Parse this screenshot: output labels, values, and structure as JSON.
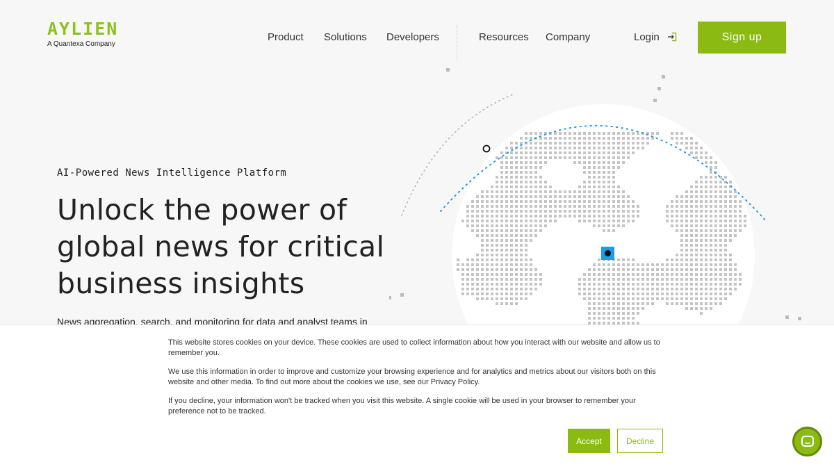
{
  "header": {
    "logo_text": "AYLIEN",
    "logo_subtitle": "A Quantexa Company",
    "nav": [
      "Product",
      "Solutions",
      "Developers",
      "Resources",
      "Company"
    ],
    "login_label": "Login",
    "signup_label": "Sign up"
  },
  "hero": {
    "eyebrow": "AI-Powered News Intelligence Platform",
    "headline_lines": [
      "Unlock the power of",
      "global news for critical",
      "business insights"
    ],
    "subtext": "News aggregation, search, and monitoring for data and analyst teams in"
  },
  "cookie_banner": {
    "paragraphs": [
      "This website stores cookies on your device. These cookies are used to collect information about how you interact with our website and allow us to remember you.",
      "We use this information in order to improve and customize your browsing experience and for analytics and metrics about our visitors both on this website and other media. To find out more about the cookies we use, see our Privacy Policy.",
      "If you decline, your information won't be tracked when you visit this website. A single cookie will be used in your browser to remember your preference not to be tracked."
    ],
    "accept_label": "Accept",
    "decline_label": "Decline"
  },
  "icons": {
    "login": "login-arrow-icon",
    "chat": "chat-bubble-icon"
  },
  "colors": {
    "brand_green": "#8bbb12",
    "dot_blue": "#1e9be9",
    "dot_grey": "#c4c4c4",
    "text": "#222222"
  }
}
